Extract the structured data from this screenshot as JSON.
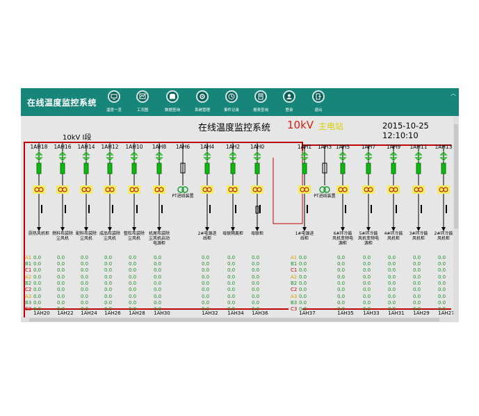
{
  "app": {
    "title": "在线温度监控系统"
  },
  "nav": [
    {
      "label": "温度一览",
      "icon": "monitor-icon"
    },
    {
      "label": "工况图",
      "icon": "diagram-icon"
    },
    {
      "label": "数据查询",
      "icon": "database-icon"
    },
    {
      "label": "系统管理",
      "icon": "gear-icon"
    },
    {
      "label": "事件记录",
      "icon": "event-icon"
    },
    {
      "label": "报表查询",
      "icon": "report-icon"
    },
    {
      "label": "登录",
      "icon": "user-icon"
    },
    {
      "label": "退出",
      "icon": "exit-icon"
    }
  ],
  "header": {
    "title": "在线温度监控系统",
    "voltage": "10kV",
    "status": "主电站",
    "datetime": "2015-10-25 12:10:10"
  },
  "section": "10kV I段",
  "feeders": [
    {
      "code": "1AH18",
      "name": "厨热风机柜",
      "bottom": "1AH20"
    },
    {
      "code": "1AH16",
      "name": "燃料布袋除尘风机",
      "bottom": "1AH22"
    },
    {
      "code": "1AH14",
      "name": "配料布袋除尘风机",
      "bottom": "1AH24"
    },
    {
      "code": "1AH12",
      "name": "成品布袋除尘风机",
      "bottom": "1AH26"
    },
    {
      "code": "1AH10",
      "name": "整粒布袋除尘风机",
      "bottom": "1AH28"
    },
    {
      "code": "1AH8",
      "name": "机尾布袋除尘风机启动电源柜",
      "bottom": "1AH30"
    },
    {
      "code": "1AH6",
      "name": "PT进线装置",
      "bottom": ""
    },
    {
      "code": "1AH4",
      "name": "2#电源进线柜",
      "bottom": "1AH32"
    },
    {
      "code": "1AH2",
      "name": "母联隔离柜",
      "bottom": "1AH34"
    },
    {
      "code": "1AH0",
      "name": "母联柜",
      "bottom": "1AH36"
    },
    {
      "code": "1AH1",
      "name": "1#电源进线柜",
      "bottom": "1AH37"
    },
    {
      "code": "1AH3",
      "name": "PT进线装置",
      "bottom": ""
    },
    {
      "code": "1AH5",
      "name": "6#环冷鼓风机变频电源柜",
      "bottom": "1AH35"
    },
    {
      "code": "1AH7",
      "name": "5#环冷鼓风机变频电源柜",
      "bottom": "1AH33"
    },
    {
      "code": "1AH9",
      "name": "4#环冷鼓风机柜",
      "bottom": "1AH31"
    },
    {
      "code": "1AH11",
      "name": "3#环冷鼓风机柜",
      "bottom": "1AH29"
    },
    {
      "code": "1AH13",
      "name": "2#环冷鼓风机柜",
      "bottom": "1AH27"
    }
  ],
  "measure": {
    "labels": [
      "A1",
      "B1",
      "C1",
      "A2",
      "B2",
      "C2",
      "A3",
      "B3",
      "C3"
    ],
    "value": "0.0"
  },
  "colors": {
    "accent": "#17857a",
    "bus": "#c00000",
    "breaker": "#11b511",
    "arrow": "#2cbd2c",
    "sensor": "#f2ef5a",
    "value": "#1c8f2a",
    "phase_a": "#d6a200",
    "phase_b": "#1c8f2a",
    "phase_c": "#c00000"
  }
}
